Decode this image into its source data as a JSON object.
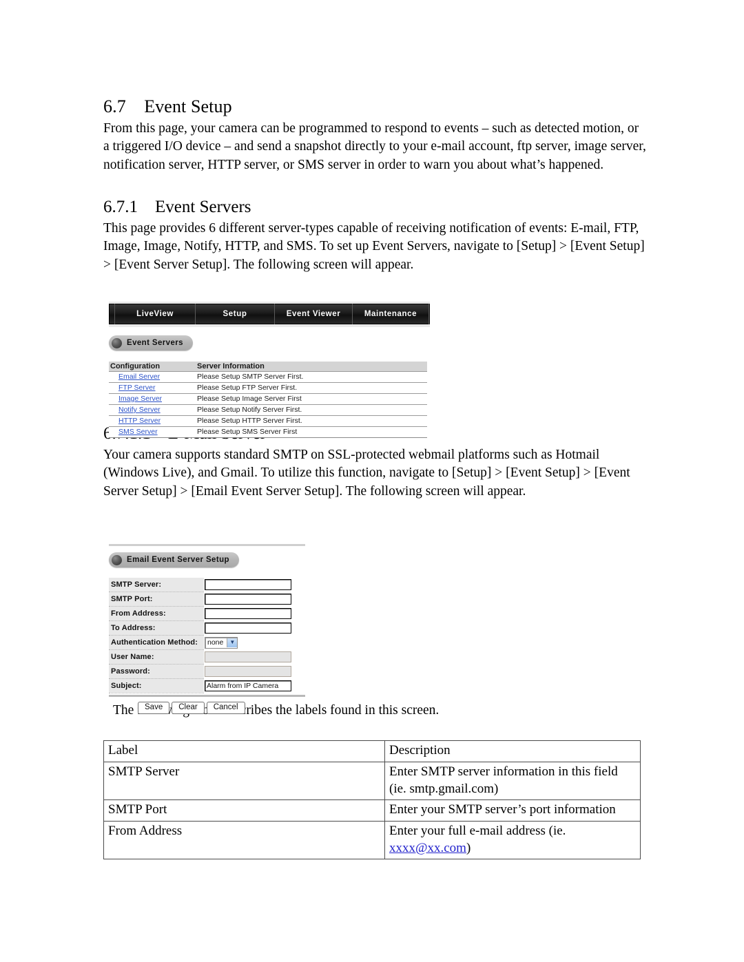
{
  "document": {
    "section": {
      "number": "6.7",
      "title": "Event Setup",
      "paragraph": "From this page, your camera can be programmed to respond to events – such as detected motion, or a triggered I/O device – and send a snapshot directly to your e-mail account, ftp server, image server, notification server, HTTP server, or SMS server in order to warn you about what’s happened."
    },
    "subsection": {
      "number": "6.7.1",
      "title": "Event Servers",
      "paragraph": "This page provides 6 different server-types capable of receiving notification of events: E-mail, FTP, Image, Image, Notify, HTTP, and SMS. To set up Event Servers, navigate to [Setup] > [Event Setup] > [Event Server Setup]. The following screen will appear."
    },
    "subsubsection": {
      "number": "6.7.1.1",
      "title": "E-Mail Server",
      "paragraph": "Your camera supports standard SMTP on SSL-protected webmail platforms such as Hotmail (Windows Live), and Gmail. To utilize this function, navigate to [Setup] > [Event Setup] > [Event Server Setup] > [Email Event Server Setup]. The following screen will appear."
    },
    "table_intro": "The following table describes the labels found in this screen."
  },
  "event_servers_screen": {
    "nav_tabs": [
      {
        "label": "LiveView"
      },
      {
        "label": "Setup"
      },
      {
        "label": "Event Viewer"
      },
      {
        "label": "Maintenance"
      }
    ],
    "panel_title": "Event Servers",
    "table": {
      "headers": [
        "Configuration",
        "Server Information"
      ],
      "rows": [
        {
          "configuration": "Email Server",
          "info": "Please Setup SMTP Server First."
        },
        {
          "configuration": "FTP Server",
          "info": "Please Setup FTP Server First."
        },
        {
          "configuration": "Image Server",
          "info": "Please Setup Image Server First"
        },
        {
          "configuration": "Notify Server",
          "info": "Please Setup Notify Server First."
        },
        {
          "configuration": "HTTP Server",
          "info": "Please Setup HTTP Server First."
        },
        {
          "configuration": "SMS Server",
          "info": "Please Setup SMS Server First"
        }
      ]
    },
    "link_color": "#2b52c8"
  },
  "email_setup_screen": {
    "panel_title": "Email Event Server Setup",
    "fields": [
      {
        "label": "SMTP Server:",
        "value": "",
        "type": "text",
        "disabled": false
      },
      {
        "label": "SMTP Port:",
        "value": "",
        "type": "text",
        "disabled": false
      },
      {
        "label": "From Address:",
        "value": "",
        "type": "text",
        "disabled": false
      },
      {
        "label": "To Address:",
        "value": "",
        "type": "text",
        "disabled": false
      },
      {
        "label": "Authentication Method:",
        "value": "none",
        "type": "select",
        "disabled": false
      },
      {
        "label": "User Name:",
        "value": "",
        "type": "text",
        "disabled": true
      },
      {
        "label": "Password:",
        "value": "",
        "type": "text",
        "disabled": true
      },
      {
        "label": "Subject:",
        "value": "Alarm from IP Camera",
        "type": "text",
        "disabled": false
      }
    ],
    "buttons": [
      {
        "label": "Save"
      },
      {
        "label": "Clear"
      },
      {
        "label": "Cancel"
      }
    ]
  },
  "description_table": {
    "headers": [
      "Label",
      "Description"
    ],
    "rows": [
      {
        "label": "SMTP Server",
        "description": "Enter SMTP server information in this field (ie. smtp.gmail.com)"
      },
      {
        "label": "SMTP Port",
        "description": "Enter your SMTP server’s port information"
      },
      {
        "label": "From Address",
        "description_prefix": "Enter your full e-mail address (ie. ",
        "description_link": "xxxx@xx.com",
        "description_suffix": ")"
      }
    ]
  }
}
